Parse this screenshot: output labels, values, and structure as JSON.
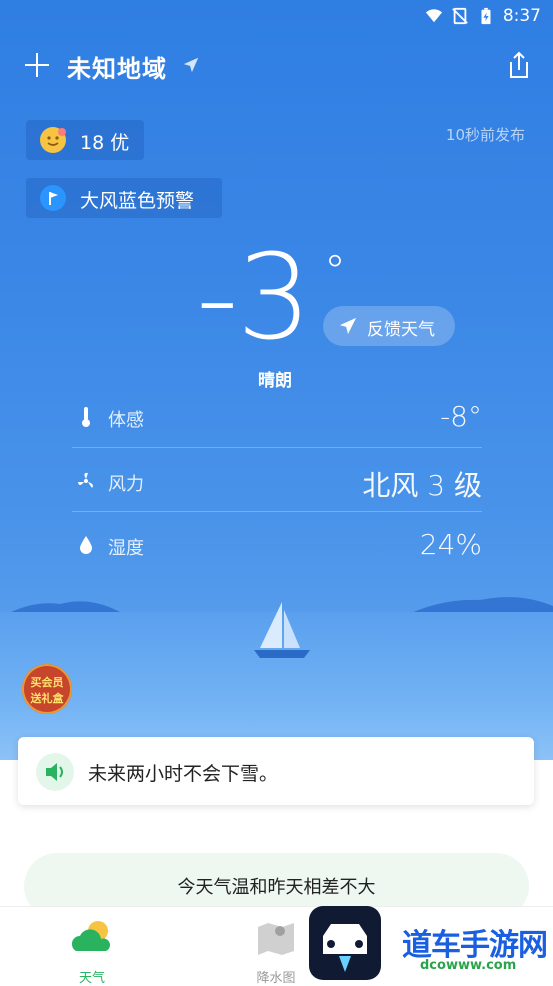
{
  "status_bar": {
    "time": "8:37"
  },
  "header": {
    "location": "未知地域"
  },
  "air_quality": {
    "value": "18 优"
  },
  "publish_time": "10秒前发布",
  "warning": {
    "label": "大风蓝色预警"
  },
  "current": {
    "temperature": "-3",
    "degree_symbol": "°",
    "condition": "晴朗",
    "feedback_label": "反馈天气"
  },
  "details": [
    {
      "name": "体感",
      "value": "-8°",
      "icon": "thermometer-icon"
    },
    {
      "name": "风力",
      "value": "北风 3 级",
      "icon": "fan-icon"
    },
    {
      "name": "湿度",
      "value": "24%",
      "icon": "droplet-icon"
    }
  ],
  "vip_badge": {
    "line1": "买会员",
    "line2": "送礼盒"
  },
  "nowcast": {
    "text": "未来两小时不会下雪。"
  },
  "compare": {
    "text": "今天气温和昨天相差不大"
  },
  "tabs": [
    {
      "label": "天气",
      "color": "#2ab35e"
    },
    {
      "label": "降水图",
      "color": "#999999"
    }
  ],
  "watermark": {
    "text": "道车手游网",
    "sub": "dcowww.com"
  },
  "colors": {
    "accent": "#2ab35e",
    "sky": "#3a86e6"
  }
}
